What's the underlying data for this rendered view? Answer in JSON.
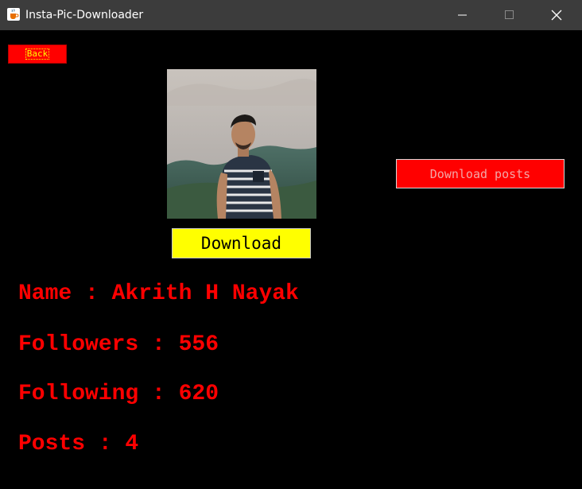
{
  "window": {
    "title": "Insta-Pic-Downloader",
    "icon": "java-cup-icon"
  },
  "buttons": {
    "back_label": "Back",
    "download_label": "Download",
    "download_posts_label": "Download posts"
  },
  "profile": {
    "name_text": "Name : Akrith H Nayak",
    "followers_text": "Followers : 556",
    "following_text": "Following : 620",
    "posts_text": "Posts : 4"
  },
  "colors": {
    "background": "#000000",
    "accent_red": "#ff0000",
    "accent_yellow": "#ffff00",
    "titlebar": "#3c3c3c"
  }
}
